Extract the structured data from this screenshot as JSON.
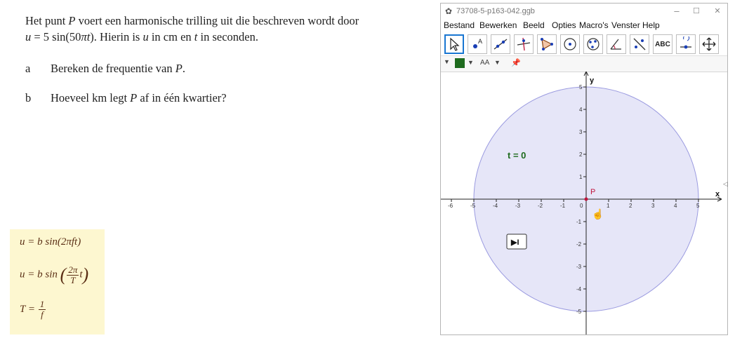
{
  "exercise": {
    "intro_line1_a": "Het punt ",
    "intro_line1_p": "P",
    "intro_line1_b": " voert een harmonische trilling uit die beschreven wordt door",
    "intro_line2_u": "u",
    "intro_line2_eq": " = 5 sin(50",
    "intro_line2_pit": "πt",
    "intro_line2_c": "). Hierin is ",
    "intro_line2_u2": "u",
    "intro_line2_d": " in cm en ",
    "intro_line2_t": "t",
    "intro_line2_e": " in seconden.",
    "questions": [
      {
        "letter": "a",
        "text_a": "Bereken de frequentie van ",
        "text_p": "P",
        "text_b": "."
      },
      {
        "letter": "b",
        "text_a": "Hoeveel km legt ",
        "text_p": "P",
        "text_b": " af in één kwartier?"
      }
    ]
  },
  "formulas": {
    "f1": "u = b sin(2πft)",
    "f2_lhs": "u = b sin",
    "f2_num": "2π",
    "f2_den": "T",
    "f2_t": "t",
    "f3_lhs": "T =",
    "f3_num": "1",
    "f3_den": "f"
  },
  "window": {
    "title": "73708-5-p163-042.ggb",
    "minimize": "–",
    "maximize": "☐",
    "close": "✕",
    "menu": [
      "Bestand",
      "Bewerken",
      "Beeld",
      "Opties",
      "Macro's",
      "Venster",
      "Help"
    ],
    "tools": [
      "move-tool",
      "point-tool",
      "line-tool",
      "perpendicular-tool",
      "polygon-tool",
      "circle-center-tool",
      "circle-three-points-tool",
      "angle-tool",
      "reflect-tool",
      "text-tool",
      "slider-tool",
      "move-graphics-tool"
    ],
    "text_tool_label": "ABC",
    "stylebar_font_label": "AA",
    "color_green": "#1e6b1e",
    "accent": "#1976d2"
  },
  "graph": {
    "x_axis_label": "x",
    "y_axis_label": "y",
    "x_ticks": [
      "-6",
      "-5",
      "-4",
      "-3",
      "-2",
      "-1",
      "0",
      "1",
      "2",
      "3",
      "4",
      "5"
    ],
    "y_ticks_pos": [
      "5",
      "4",
      "3",
      "2",
      "1"
    ],
    "y_ticks_neg": [
      "-1",
      "-2",
      "-3",
      "-4",
      "-5"
    ],
    "circle_radius": 5,
    "point_label": "P",
    "point": [
      0,
      0
    ],
    "time_label": "t = 0",
    "play_symbol": "▶I",
    "circle_fill": "#e6e6f8",
    "circle_stroke": "#9b9be0",
    "point_color": "#c0143c"
  }
}
